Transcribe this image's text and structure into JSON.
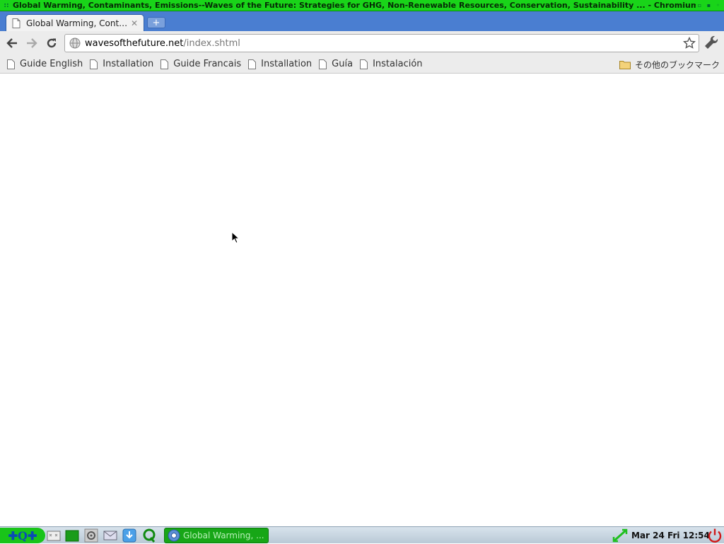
{
  "window": {
    "title": "Global Warming, Contaminants, Emissions--Waves of the Future: Strategies for GHG, Non-Renewable Resources, Conservation, Sustainability ... - Chromium"
  },
  "tabs": [
    {
      "label": "Global Warming, Cont…",
      "active": true
    }
  ],
  "omnibox": {
    "host": "wavesofthefuture.net",
    "path": "/index.shtml"
  },
  "bookmarks": {
    "items": [
      {
        "label": "Guide English"
      },
      {
        "label": "Installation"
      },
      {
        "label": "Guide Francais"
      },
      {
        "label": "Installation"
      },
      {
        "label": "Guía"
      },
      {
        "label": "Instalación"
      }
    ],
    "other_label": "その他のブックマーク"
  },
  "taskbar": {
    "start_glyphs": "✚Q✚",
    "task_label": "Global Warming, ...",
    "clock": "Mar 24 Fri 12:54"
  },
  "colors": {
    "titlebar": "#19d419",
    "tabstrip": "#4a7ed1",
    "taskbar_task": "#17a617"
  }
}
